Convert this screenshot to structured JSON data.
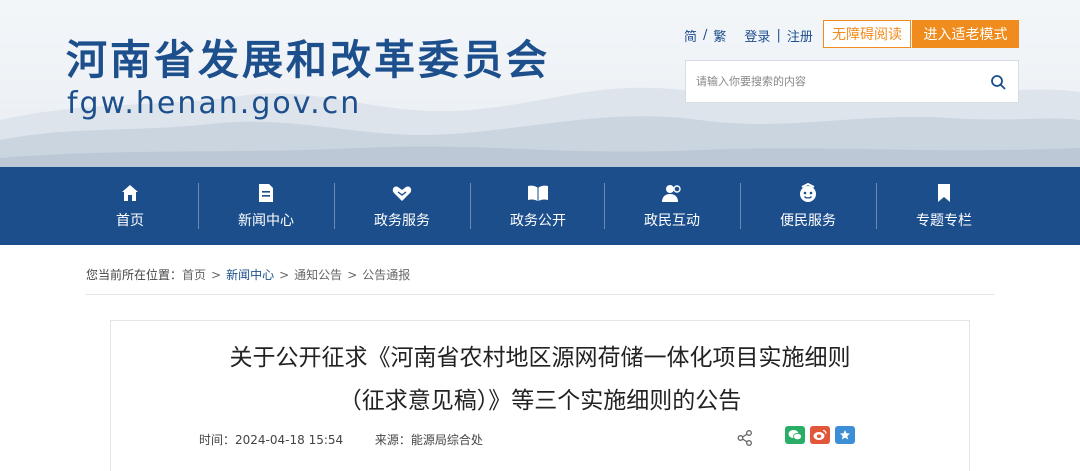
{
  "header": {
    "site_title": "河南省发展和改革委员会",
    "site_domain": "fgw.henan.gov.cn",
    "lang_simplified": "简",
    "lang_traditional": "繁",
    "login": "登录",
    "register": "注册",
    "accessible_reading": "无障碍阅读",
    "elder_mode": "进入适老模式",
    "search_placeholder": "请输入你要搜索的内容",
    "accent_color": "#f08c1e",
    "brand_color": "#1d4f8c"
  },
  "nav": {
    "items": [
      {
        "label": "首页",
        "icon": "home-icon"
      },
      {
        "label": "新闻中心",
        "icon": "news-icon"
      },
      {
        "label": "政务服务",
        "icon": "handshake-icon"
      },
      {
        "label": "政务公开",
        "icon": "book-icon"
      },
      {
        "label": "政民互动",
        "icon": "people-icon"
      },
      {
        "label": "便民服务",
        "icon": "service-icon"
      },
      {
        "label": "专题专栏",
        "icon": "bookmark-icon"
      }
    ]
  },
  "breadcrumb": {
    "prefix": "您当前所在位置：",
    "items": [
      "首页",
      "新闻中心",
      "通知公告",
      "公告通报"
    ],
    "separator": ">"
  },
  "article": {
    "title_line1": "关于公开征求《河南省农村地区源网荷储一体化项目实施细则",
    "title_line2": "（征求意见稿）》等三个实施细则的公告",
    "time_label": "时间：",
    "time_value": "2024-04-18 15:54",
    "source_label": "来源：",
    "source_value": "能源局综合处"
  }
}
